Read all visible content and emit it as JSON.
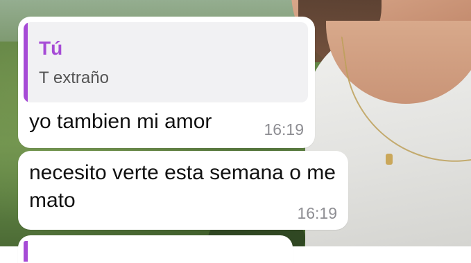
{
  "chat": {
    "messages": [
      {
        "reply_to": {
          "author": "Tú",
          "text": "T extraño"
        },
        "text": "yo tambien mi amor",
        "time": "16:19"
      },
      {
        "text": "necesito verte esta semana o me mato",
        "time": "16:19"
      }
    ]
  },
  "colors": {
    "reply_accent": "#a64bd6",
    "bubble_bg": "#ffffff",
    "quote_bg": "#f1f1f3",
    "timestamp": "#8e8e93"
  }
}
